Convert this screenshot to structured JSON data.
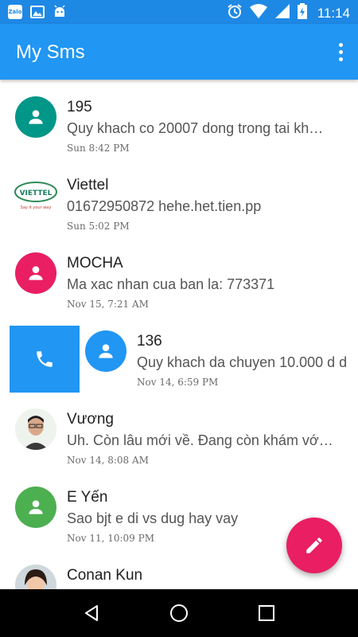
{
  "status_bar": {
    "zalo_text": "Zalo",
    "time": "11:14"
  },
  "app_bar": {
    "title": "My Sms"
  },
  "colors": {
    "primary": "#2196F3",
    "primary_dark": "#1E88E5",
    "accent": "#E91E63",
    "teal": "#009688",
    "pink": "#E91E63",
    "green": "#4CAF50",
    "blue": "#2196F3"
  },
  "conversations": [
    {
      "name": "195",
      "snippet": "Quy khach co 20007 dong trong tai kh…",
      "time": "Sun 8:42 PM",
      "avatar": "person-icon",
      "avatar_color": "#009688"
    },
    {
      "name": "Viettel",
      "snippet": "01672950872 hehe.het.tien.pp",
      "time": "Sun 5:02 PM",
      "avatar": "viettel-logo",
      "logo_text": "VIETTEL",
      "logo_tagline": "Say it your way"
    },
    {
      "name": "MOCHA",
      "snippet": "Ma xac nhan cua ban la: 773371",
      "time": "Nov 15, 7:21 AM",
      "avatar": "person-icon",
      "avatar_color": "#E91E63"
    },
    {
      "name": "136",
      "snippet": "Quy khach da chuyen 10.000 d d",
      "time": "Nov 14, 6:59 PM",
      "avatar": "person-icon",
      "avatar_color": "#2196F3",
      "swipe_action": "phone-icon"
    },
    {
      "name": "Vương",
      "snippet": "Uh. Còn lâu mới về. Đang còn khám vớ…",
      "time": "Nov 14, 8:08 AM",
      "avatar": "contact-photo"
    },
    {
      "name": "E Yến",
      "snippet": "Sao bjt e di vs dug hay vay",
      "time": "Nov 11, 10:09 PM",
      "avatar": "person-icon",
      "avatar_color": "#4CAF50"
    },
    {
      "name": "Conan Kun",
      "snippet": "",
      "time": "",
      "avatar": "contact-photo"
    }
  ],
  "fab": {
    "icon": "edit-icon"
  },
  "nav": {
    "back": "back-icon",
    "home": "home-icon",
    "recents": "recents-icon"
  }
}
